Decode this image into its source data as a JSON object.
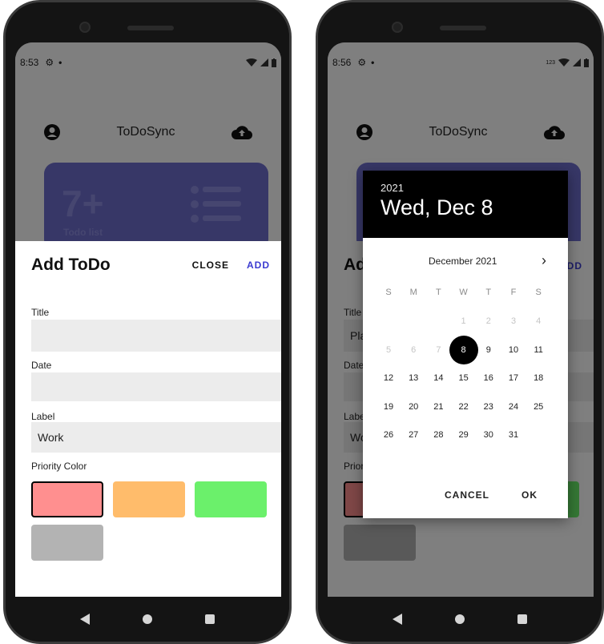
{
  "left": {
    "status": {
      "time": "8:53"
    },
    "app": {
      "title": "ToDoSync"
    },
    "summary": {
      "count": "7+",
      "label": "Todo list"
    },
    "sheet": {
      "title": "Add ToDo",
      "close_label": "CLOSE",
      "add_label": "ADD",
      "title_field_label": "Title",
      "title_value": "",
      "date_field_label": "Date",
      "date_value": "",
      "label_field_label": "Label",
      "label_value": "Work",
      "priority_label": "Priority Color",
      "priority_colors": [
        "#ff8f8f",
        "#ffbc6b",
        "#6bf06b",
        "#b3b3b3"
      ],
      "selected_priority": 0
    }
  },
  "right": {
    "status": {
      "time": "8:56",
      "badge": "123"
    },
    "app": {
      "title": "ToDoSync"
    },
    "behind": {
      "sheet_title_partial": "Ad",
      "add_partial": "ADD",
      "title_label_partial": "Title",
      "title_value_partial": "Pla",
      "date_label_partial": "Date",
      "label_label_partial": "Labe",
      "label_value_partial": "Wo",
      "priority_partial": "Priori"
    },
    "picker": {
      "year": "2021",
      "selected_date": "Wed, Dec 8",
      "month_label": "December 2021",
      "weekdays": [
        "S",
        "M",
        "T",
        "W",
        "T",
        "F",
        "S"
      ],
      "weeks": [
        [
          "",
          "",
          "",
          "1",
          "2",
          "3",
          "4"
        ],
        [
          "5",
          "6",
          "7",
          "8",
          "9",
          "10",
          "11"
        ],
        [
          "12",
          "13",
          "14",
          "15",
          "16",
          "17",
          "18"
        ],
        [
          "19",
          "20",
          "21",
          "22",
          "23",
          "24",
          "25"
        ],
        [
          "26",
          "27",
          "28",
          "29",
          "30",
          "31",
          ""
        ]
      ],
      "selected_day": "8",
      "disabled_days": [
        "1",
        "2",
        "3",
        "4",
        "5",
        "6",
        "7"
      ],
      "cancel_label": "CANCEL",
      "ok_label": "OK"
    }
  },
  "colors": {
    "accent": "#3a3ad0",
    "card": "#6f6fcf",
    "header": "#000000"
  }
}
